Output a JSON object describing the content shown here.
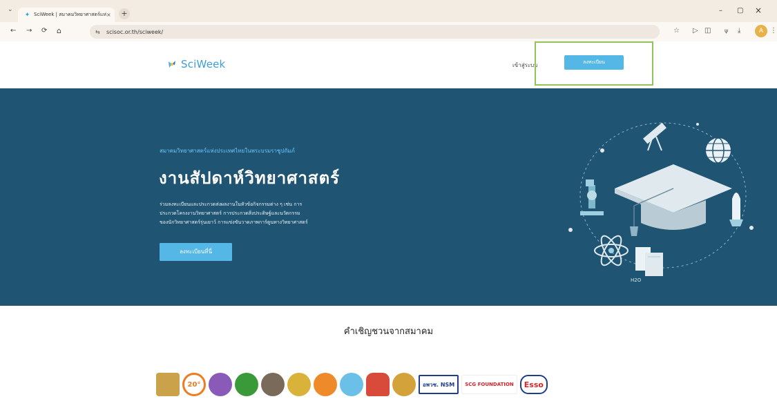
{
  "browser": {
    "tab_title": "SciWeek | สมาคมวิทยาศาสตร์แห่ง",
    "tab_close": "×",
    "new_tab": "+",
    "tab_list": "⌄",
    "url": "scisoc.or.th/sciweek/",
    "win_min": "–",
    "win_max": "▢",
    "win_close": "×",
    "back": "←",
    "forward": "→",
    "reload": "⟳",
    "home": "⌂",
    "avatar_letter": "A"
  },
  "header": {
    "logo_text": "SciWeek",
    "login_label": "เข้าสู่ระบบ",
    "register_label": "ลงทะเบียน"
  },
  "hero": {
    "eyebrow": "สมาคมวิทยาศาสตร์แห่งประเทศไทยในพระบรมราชูปถัมภ์",
    "title": "งานสัปดาห์วิทยาศาสตร์",
    "description_lines": [
      "ร่วมลงทะเบียนและประกวดส่งผลงานในหัวข้อกิจกรรมต่าง ๆ เช่น การ",
      "ประกวดโครงงานวิทยาศาสตร์ การประกวดสิ่งประดิษฐ์และนวัตกรรม",
      "ของนักวิทยาศาสตร์รุ่นเยาว์ การแข่งขันวาดภาพการ์ตูนทางวิทยาศาสตร์"
    ],
    "cta_label": "ลงทะเบียนที่นี่",
    "art_labels": {
      "h2o": "H2O"
    }
  },
  "invite": {
    "heading": "คำเชิญชวนจากสมาคม",
    "logos": [
      {
        "name": "moe-logo",
        "color": "#c9a24a"
      },
      {
        "name": "20-years-logo",
        "color": "#ef7b1f",
        "text": "20°"
      },
      {
        "name": "violet-seal-logo",
        "color": "#8a5ab8"
      },
      {
        "name": "green-seal-logo",
        "color": "#3a9a3a"
      },
      {
        "name": "elephant-seal-logo",
        "color": "#7a6a5a"
      },
      {
        "name": "gold-seal-logo",
        "color": "#d9b23a"
      },
      {
        "name": "orange-seal-logo",
        "color": "#ee8a2a"
      },
      {
        "name": "science-center-logo",
        "color": "#6bc0e8"
      },
      {
        "name": "temple-logo",
        "color": "#d84a3a"
      },
      {
        "name": "gold-emblem-logo",
        "color": "#d4a23a"
      },
      {
        "name": "nsm-logo",
        "color": "#1f3d8a",
        "text": "อพวช. NSM"
      },
      {
        "name": "scg-foundation-logo",
        "color": "#d8232a",
        "text": "SCG FOUNDATION"
      },
      {
        "name": "esso-logo",
        "color": "#d8232a",
        "text": "Esso"
      }
    ]
  }
}
